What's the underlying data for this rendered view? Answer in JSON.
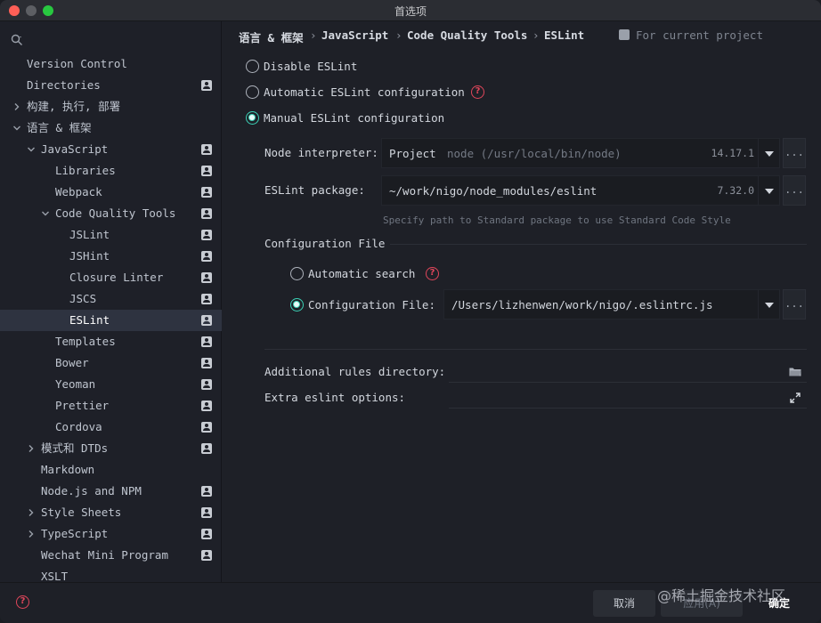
{
  "window": {
    "title": "首选项"
  },
  "sidebar": {
    "search_placeholder": "",
    "items": [
      {
        "label": "Version Control",
        "has_project_icon": false,
        "expander": "none",
        "selected": false
      },
      {
        "label": "Directories",
        "has_project_icon": true,
        "expander": "none",
        "selected": false
      },
      {
        "label": "构建, 执行, 部署",
        "has_project_icon": false,
        "expander": "collapsed",
        "selected": false
      },
      {
        "label": "语言 & 框架",
        "has_project_icon": false,
        "expander": "expanded",
        "selected": false
      },
      {
        "label": "JavaScript",
        "has_project_icon": true,
        "expander": "expanded",
        "selected": false
      },
      {
        "label": "Libraries",
        "has_project_icon": true,
        "expander": "none",
        "selected": false
      },
      {
        "label": "Webpack",
        "has_project_icon": true,
        "expander": "none",
        "selected": false
      },
      {
        "label": "Code Quality Tools",
        "has_project_icon": true,
        "expander": "expanded",
        "selected": false
      },
      {
        "label": "JSLint",
        "has_project_icon": true,
        "expander": "none",
        "selected": false
      },
      {
        "label": "JSHint",
        "has_project_icon": true,
        "expander": "none",
        "selected": false
      },
      {
        "label": "Closure Linter",
        "has_project_icon": true,
        "expander": "none",
        "selected": false
      },
      {
        "label": "JSCS",
        "has_project_icon": true,
        "expander": "none",
        "selected": false
      },
      {
        "label": "ESLint",
        "has_project_icon": true,
        "expander": "none",
        "selected": true
      },
      {
        "label": "Templates",
        "has_project_icon": true,
        "expander": "none",
        "selected": false
      },
      {
        "label": "Bower",
        "has_project_icon": true,
        "expander": "none",
        "selected": false
      },
      {
        "label": "Yeoman",
        "has_project_icon": true,
        "expander": "none",
        "selected": false
      },
      {
        "label": "Prettier",
        "has_project_icon": true,
        "expander": "none",
        "selected": false
      },
      {
        "label": "Cordova",
        "has_project_icon": true,
        "expander": "none",
        "selected": false
      },
      {
        "label": "模式和 DTDs",
        "has_project_icon": true,
        "expander": "collapsed",
        "selected": false
      },
      {
        "label": "Markdown",
        "has_project_icon": false,
        "expander": "none",
        "selected": false
      },
      {
        "label": "Node.js and NPM",
        "has_project_icon": true,
        "expander": "none",
        "selected": false
      },
      {
        "label": "Style Sheets",
        "has_project_icon": true,
        "expander": "collapsed",
        "selected": false
      },
      {
        "label": "TypeScript",
        "has_project_icon": true,
        "expander": "collapsed",
        "selected": false
      },
      {
        "label": "Wechat Mini Program",
        "has_project_icon": true,
        "expander": "none",
        "selected": false
      },
      {
        "label": "XSLT",
        "has_project_icon": false,
        "expander": "none",
        "selected": false
      }
    ]
  },
  "breadcrumb": {
    "items": [
      "语言 & 框架",
      "JavaScript",
      "Code Quality Tools",
      "ESLint"
    ],
    "separator": "›",
    "scope_label": "For current project"
  },
  "eslint": {
    "mode_options": [
      {
        "label": "Disable ESLint",
        "checked": false,
        "help": false
      },
      {
        "label": "Automatic ESLint configuration",
        "checked": false,
        "help": true
      },
      {
        "label": "Manual ESLint configuration",
        "checked": true,
        "help": false
      }
    ],
    "node_interpreter": {
      "label": "Node interpreter:",
      "value": "Project",
      "detail": "node (/usr/local/bin/node)",
      "version": "14.17.1"
    },
    "eslint_package": {
      "label": "ESLint package:",
      "value": "~/work/nigo/node_modules/eslint",
      "version": "7.32.0",
      "hint": "Specify path to Standard package to use Standard Code Style"
    },
    "config_file_section": {
      "title": "Configuration File",
      "options": [
        {
          "label": "Automatic search",
          "checked": false,
          "help": true
        },
        {
          "label": "Configuration File:",
          "checked": true,
          "help": false
        }
      ],
      "config_path": "/Users/lizhenwen/work/nigo/.eslintrc.js"
    },
    "additional_rules_label": "Additional rules directory:",
    "additional_rules_value": "",
    "extra_options_label": "Extra eslint options:",
    "extra_options_value": "",
    "browse_label": "..."
  },
  "footer": {
    "help_glyph": "?",
    "cancel_label": "取消",
    "apply_label": "应用(A)",
    "ok_label": "确定",
    "watermark": "@稀土掘金技术社区"
  },
  "colors": {
    "accent": "#3bd1b6",
    "help": "#e0465b",
    "selection": "#2e3340",
    "background": "#1e2027"
  }
}
